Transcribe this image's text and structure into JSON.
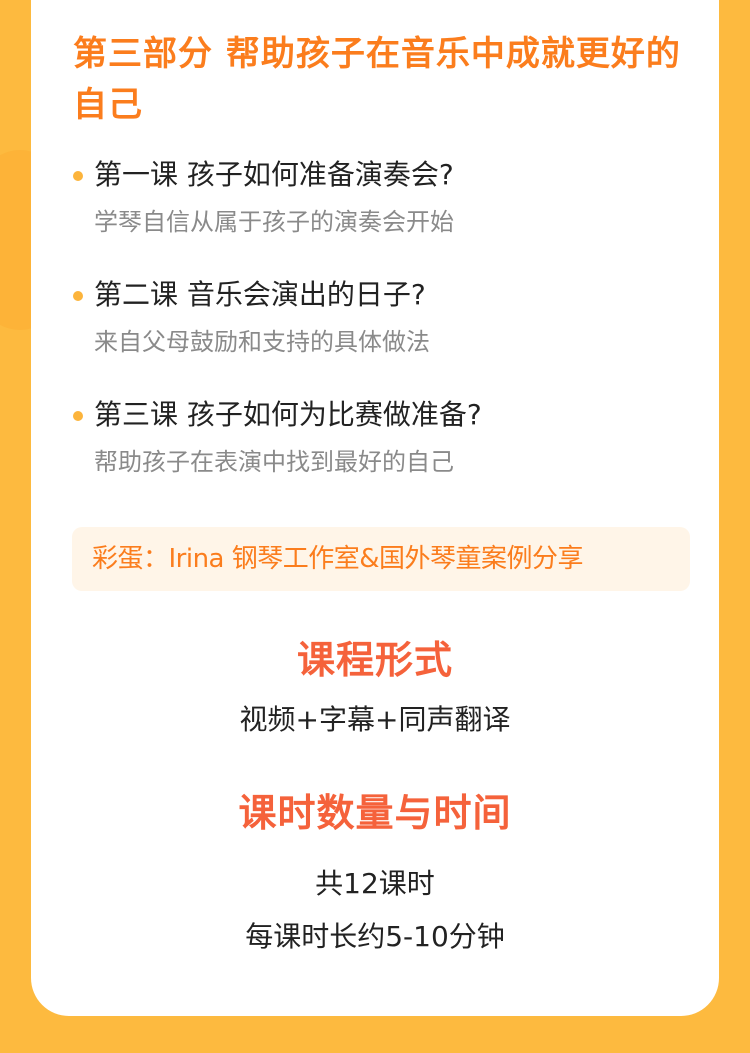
{
  "section": {
    "title": "第三部分  帮助孩子在音乐中成就更好的自己"
  },
  "lessons": [
    {
      "title": "第一课 孩子如何准备演奏会?",
      "subtitle": "学琴自信从属于孩子的演奏会开始"
    },
    {
      "title": "第二课 音乐会演出的日子?",
      "subtitle": "来自父母鼓励和支持的具体做法"
    },
    {
      "title": "第三课 孩子如何为比赛做准备?",
      "subtitle": "帮助孩子在表演中找到最好的自己"
    }
  ],
  "bonus": {
    "text": "彩蛋：Irina 钢琴工作室&国外琴童案例分享"
  },
  "format": {
    "heading": "课程形式",
    "text": "视频+字幕+同声翻译"
  },
  "duration": {
    "heading": "课时数量与时间",
    "total": "共12课时",
    "per_lesson": "每课时长约5-10分钟"
  },
  "colors": {
    "background": "#fdba3f",
    "card": "#ffffff",
    "accent_orange": "#fb7d1d",
    "heading_red_orange": "#f5623b",
    "bullet": "#fcb43c",
    "bonus_bg": "#fff5e8",
    "body_text": "#222222",
    "muted_text": "#8a8a8a"
  }
}
